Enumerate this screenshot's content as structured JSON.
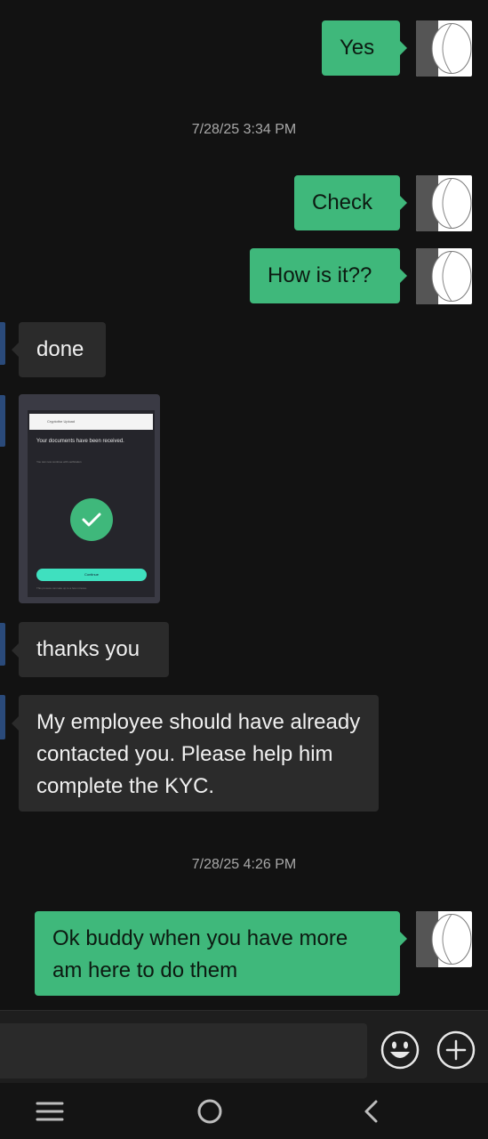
{
  "messages": {
    "m1": {
      "text": "Yes"
    },
    "ts1": {
      "text": "7/28/25 3:34 PM"
    },
    "m2": {
      "text": "Check"
    },
    "m3": {
      "text": "How is it??"
    },
    "m4": {
      "text": "done"
    },
    "m5_image": {
      "header_text": "Cryptothe Upload",
      "title_text": "Your documents have been received.",
      "sub_text": "You can now continue with verification",
      "button_text": "Continue",
      "footer_text": "This process can take up to a few minutes."
    },
    "m6": {
      "text": "thanks you"
    },
    "m7": {
      "text": "My employee should have already contacted you. Please help him complete the KYC."
    },
    "ts2": {
      "text": "7/28/25 4:26 PM"
    },
    "m8": {
      "text": "Ok buddy when you have more am here to do them"
    }
  },
  "composer": {
    "placeholder": "",
    "emoji_icon": "smiley-face-icon",
    "add_icon": "plus-circle-icon"
  },
  "navbar": {
    "recents_icon": "menu-lines-icon",
    "home_icon": "circle-home-icon",
    "back_icon": "chevron-left-icon"
  },
  "colors": {
    "outgoing_bubble": "#3fb87b",
    "incoming_bubble": "#2b2b2b",
    "background": "#121212"
  }
}
